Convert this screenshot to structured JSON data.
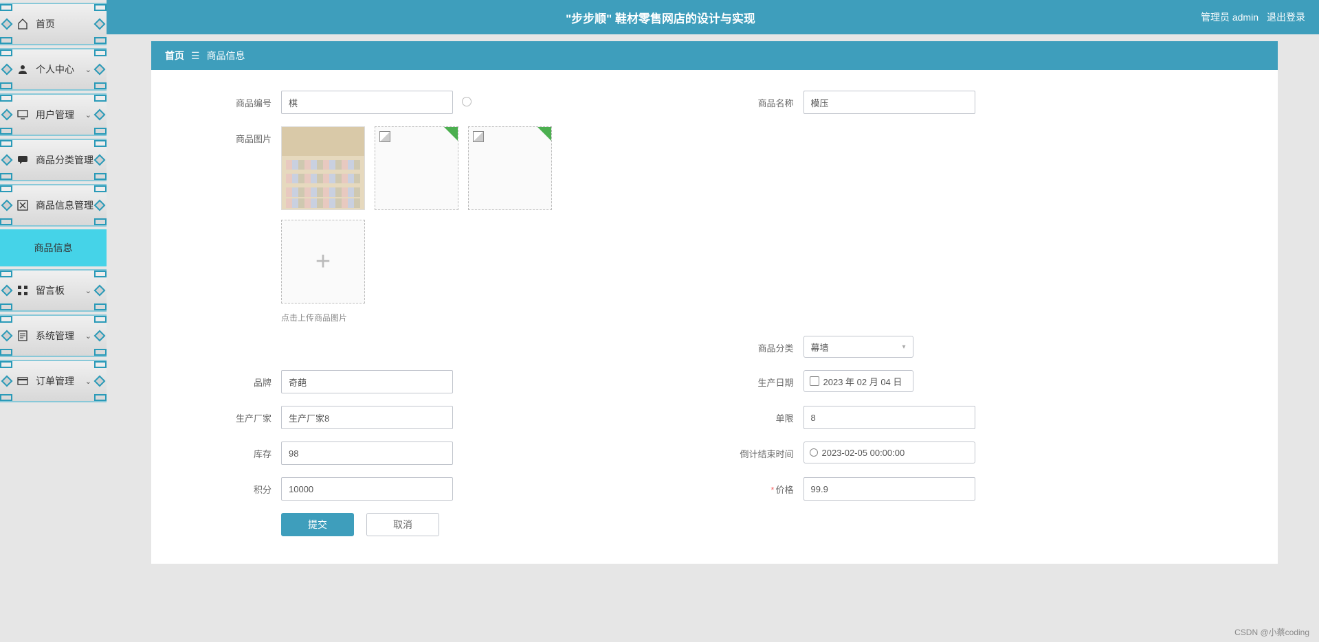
{
  "header": {
    "title": "\"步步顺\" 鞋材零售网店的设计与实现",
    "admin_label": "管理员 admin",
    "logout": "退出登录"
  },
  "sidebar": {
    "items": [
      {
        "label": "首页",
        "icon": "home"
      },
      {
        "label": "个人中心",
        "icon": "user",
        "expandable": true
      },
      {
        "label": "用户管理",
        "icon": "monitor",
        "expandable": true
      },
      {
        "label": "商品分类管理",
        "icon": "chat",
        "expandable": true
      },
      {
        "label": "商品信息管理",
        "icon": "cross",
        "expandable": true
      },
      {
        "label": "留言板",
        "icon": "grid",
        "expandable": true
      },
      {
        "label": "系统管理",
        "icon": "doc",
        "expandable": true
      },
      {
        "label": "订单管理",
        "icon": "card",
        "expandable": true
      }
    ],
    "sub_item": "商品信息"
  },
  "breadcrumb": {
    "home": "首页",
    "current": "商品信息"
  },
  "form": {
    "labels": {
      "product_no": "商品编号",
      "product_name": "商品名称",
      "product_img": "商品图片",
      "upload_hint": "点击上传商品图片",
      "category": "商品分类",
      "brand": "品牌",
      "prod_date": "生产日期",
      "manufacturer": "生产厂家",
      "limit": "单限",
      "stock": "库存",
      "countdown_end": "倒计结束时间",
      "points": "积分",
      "price": "价格"
    },
    "values": {
      "product_no": "棋",
      "product_name": "模压",
      "category": "幕墙",
      "brand": "奇葩",
      "prod_date": "2023 年 02 月 04 日",
      "manufacturer": "生产厂家8",
      "limit": "8",
      "stock": "98",
      "countdown_end": "2023-02-05 00:00:00",
      "points": "10000",
      "price": "99.9"
    },
    "buttons": {
      "submit": "提交",
      "cancel": "取消"
    }
  },
  "watermark": "CSDN @小蔡coding"
}
